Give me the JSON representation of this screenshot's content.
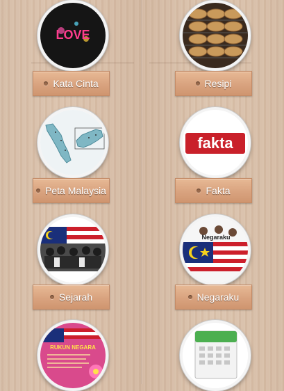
{
  "menu": {
    "items": [
      {
        "label": "Kata Cinta",
        "icon": "love-text-icon"
      },
      {
        "label": "Resipi",
        "icon": "bread-icon"
      },
      {
        "label": "Peta Malaysia",
        "icon": "malaysia-map-icon"
      },
      {
        "label": "Fakta",
        "icon": "fakta-icon"
      },
      {
        "label": "Sejarah",
        "icon": "history-photo-icon"
      },
      {
        "label": "Negaraku",
        "icon": "negaraku-flag-icon"
      },
      {
        "label": "",
        "icon": "rukun-negara-icon"
      },
      {
        "label": "",
        "icon": "calendar-icon"
      }
    ]
  },
  "icon_text": {
    "love": "LOVE",
    "fakta": "fakta",
    "negaraku": "Negaraku",
    "rukun_negara": "RUKUN NEGARA"
  },
  "colors": {
    "button": "#d9a37f",
    "background": "#d8bfa9"
  }
}
